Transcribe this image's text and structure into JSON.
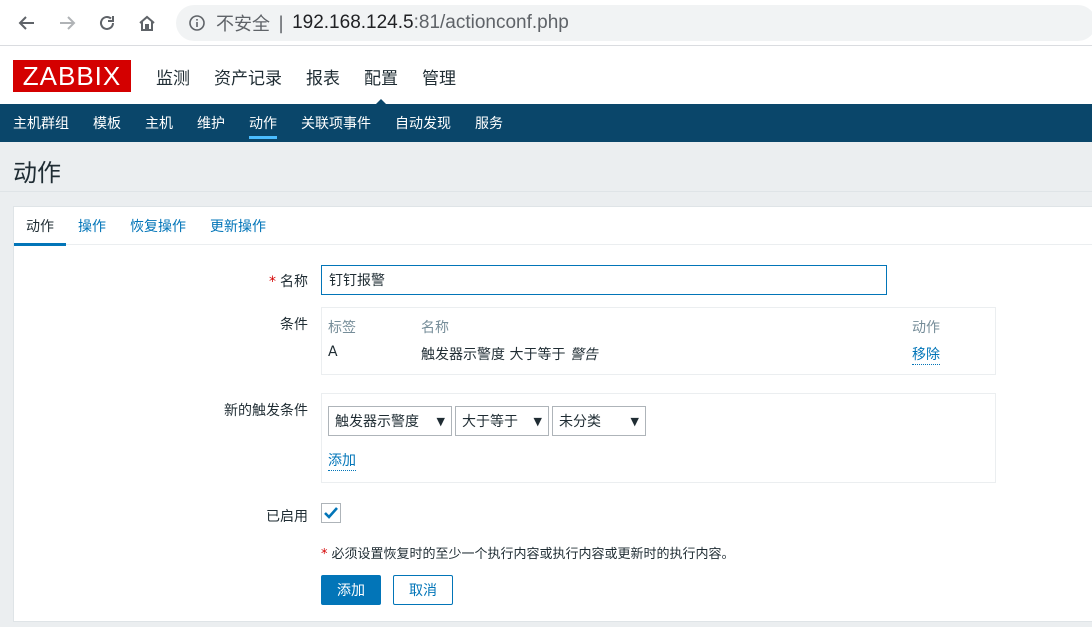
{
  "browser": {
    "insecure_label": "不安全",
    "separator": "|",
    "url_host": "192.168.124.5",
    "url_rest": ":81/actionconf.php"
  },
  "header": {
    "logo": "ZABBIX",
    "menu": [
      {
        "label": "监测"
      },
      {
        "label": "资产记录"
      },
      {
        "label": "报表"
      },
      {
        "label": "配置"
      },
      {
        "label": "管理"
      }
    ],
    "active_menu": "配置"
  },
  "subnav": {
    "items": [
      {
        "label": "主机群组"
      },
      {
        "label": "模板"
      },
      {
        "label": "主机"
      },
      {
        "label": "维护"
      },
      {
        "label": "动作"
      },
      {
        "label": "关联项事件"
      },
      {
        "label": "自动发现"
      },
      {
        "label": "服务"
      }
    ],
    "active": "动作"
  },
  "page": {
    "title": "动作"
  },
  "tabs": [
    {
      "label": "动作"
    },
    {
      "label": "操作"
    },
    {
      "label": "恢复操作"
    },
    {
      "label": "更新操作"
    }
  ],
  "form": {
    "required_mark": "*",
    "name_label": "名称",
    "name_value": "钉钉报警",
    "conditions_label": "条件",
    "conditions_table": {
      "headers": [
        "标签",
        "名称",
        "动作"
      ],
      "rows": [
        {
          "tag": "A",
          "name_text": "触发器示警度 大于等于 ",
          "name_value": "警告",
          "action": "移除"
        }
      ]
    },
    "new_condition_label": "新的触发条件",
    "new_condition": {
      "type": "触发器示警度",
      "operator": "大于等于",
      "value": "未分类",
      "add_label": "添加"
    },
    "enabled_label": "已启用",
    "enabled": true,
    "note_mark": "*",
    "note": "必须设置恢复时的至少一个执行内容或执行内容或更新时的执行内容。",
    "submit_label": "添加",
    "cancel_label": "取消"
  },
  "colors": {
    "brand_red": "#d40000",
    "nav_blue": "#0a466a",
    "link_blue": "#0275b8"
  }
}
